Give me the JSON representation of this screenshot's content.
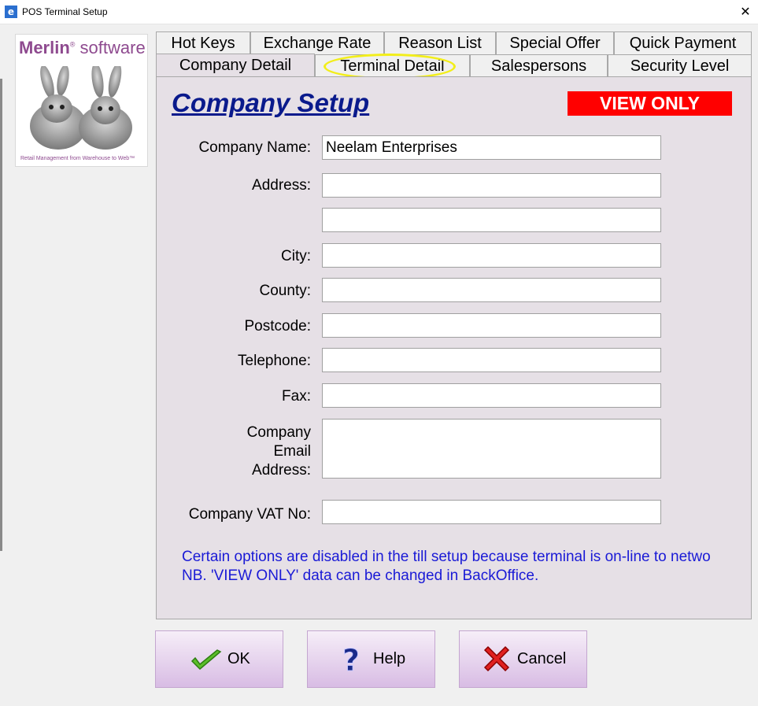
{
  "window": {
    "title": "POS Terminal Setup",
    "app_icon_glyph": "e",
    "close_glyph": "✕"
  },
  "logo": {
    "brand_bold": "Merlin",
    "brand_reg": "®",
    "brand_rest": " software",
    "tagline": "Retail Management from Warehouse to Web™"
  },
  "tabs": {
    "row1": [
      "Hot Keys",
      "Exchange Rate",
      "Reason List",
      "Special Offer",
      "Quick Payment"
    ],
    "row2": [
      "Company Detail",
      "Terminal Detail",
      "Salespersons",
      "Security Level"
    ],
    "active": "Company Detail",
    "highlighted": "Terminal Detail"
  },
  "form": {
    "heading": "Company Setup",
    "badge": "VIEW ONLY",
    "labels": {
      "company_name": "Company Name:",
      "address": "Address:",
      "city": "City:",
      "county": "County:",
      "postcode": "Postcode:",
      "telephone": "Telephone:",
      "fax": "Fax:",
      "email_line1": "Company",
      "email_line2": "Email",
      "email_line3": "Address:",
      "vat": "Company VAT No:"
    },
    "values": {
      "company_name": "Neelam Enterprises",
      "address1": "",
      "address2": "",
      "city": "",
      "county": "",
      "postcode": "",
      "telephone": "",
      "fax": "",
      "email": "",
      "vat": ""
    },
    "note_line1": "Certain options are disabled in the till setup because terminal is on-line to netwo",
    "note_line2": "NB. 'VIEW ONLY' data can be changed in BackOffice."
  },
  "buttons": {
    "ok": "OK",
    "help": "Help",
    "cancel": "Cancel"
  },
  "colors": {
    "heading": "#0a1a8c",
    "badge_bg": "#ff0000",
    "note": "#1a1ad6",
    "highlight": "#f2ee1a"
  }
}
